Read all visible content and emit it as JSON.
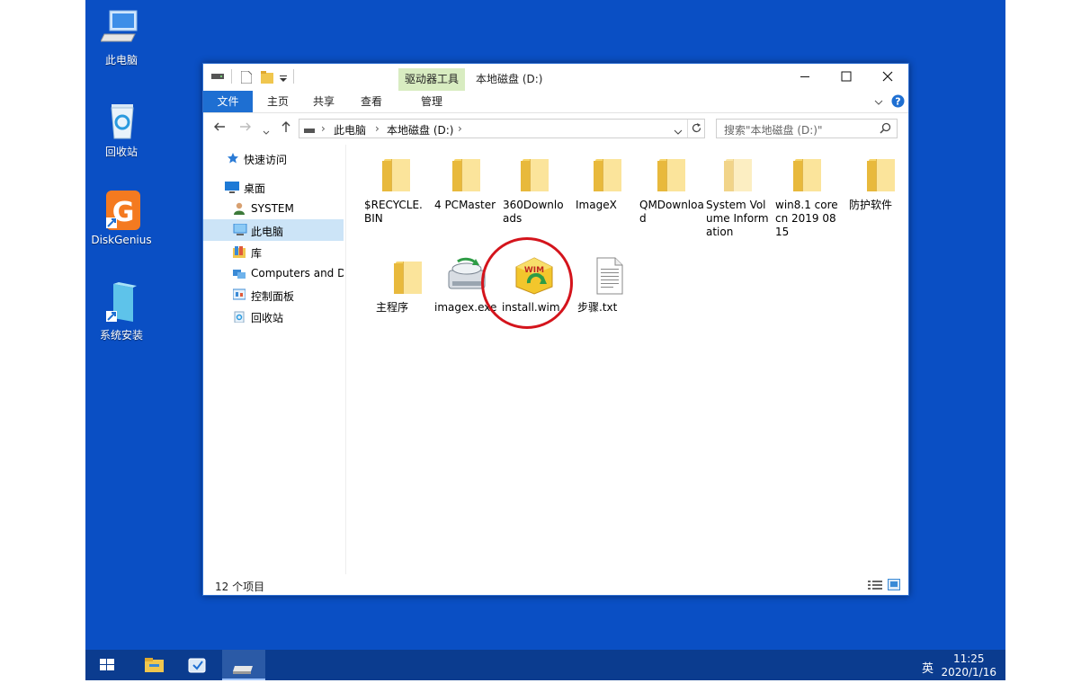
{
  "desktop": {
    "icons": [
      {
        "label": "此电脑"
      },
      {
        "label": "回收站"
      },
      {
        "label": "DiskGenius"
      },
      {
        "label": "系统安装"
      }
    ]
  },
  "window": {
    "context_tab": "驱动器工具",
    "title": "本地磁盘 (D:)",
    "ribbon_tabs": [
      "文件",
      "主页",
      "共享",
      "查看",
      "管理"
    ],
    "breadcrumb": [
      "此电脑",
      "本地磁盘 (D:)"
    ],
    "search_placeholder": "搜索\"本地磁盘 (D:)\"",
    "nav_items": [
      {
        "label": "快速访问",
        "icon": "star-icon"
      },
      {
        "label": "桌面",
        "icon": "desktop-icon"
      },
      {
        "label": "SYSTEM",
        "icon": "user-icon"
      },
      {
        "label": "此电脑",
        "icon": "computer-icon"
      },
      {
        "label": "库",
        "icon": "library-icon"
      },
      {
        "label": "Computers and D",
        "icon": "network-icon"
      },
      {
        "label": "控制面板",
        "icon": "control-panel-icon"
      },
      {
        "label": "回收站",
        "icon": "recycle-bin-icon"
      }
    ],
    "files": [
      {
        "name": "$RECYCLE.BIN",
        "type": "folder"
      },
      {
        "name": "4 PCMaster",
        "type": "folder"
      },
      {
        "name": "360Downloads",
        "type": "folder"
      },
      {
        "name": "ImageX",
        "type": "folder"
      },
      {
        "name": "QMDownload",
        "type": "folder"
      },
      {
        "name": "System Volume Information",
        "type": "folder"
      },
      {
        "name": "win8.1 core cn 2019 0815",
        "type": "folder"
      },
      {
        "name": "防护软件",
        "type": "folder"
      },
      {
        "name": "主程序",
        "type": "folder"
      },
      {
        "name": "imagex.exe",
        "type": "exe"
      },
      {
        "name": "install.wim",
        "type": "wim"
      },
      {
        "name": "步骤.txt",
        "type": "txt"
      }
    ],
    "wim_badge": "WIM",
    "status": "12 个项目"
  },
  "taskbar": {
    "ime": "英",
    "time": "11:25",
    "date": "2020/1/16"
  },
  "colors": {
    "desktop": "#0a4fc4",
    "accent": "#1e6fd2",
    "highlight_circle": "#d4141c"
  }
}
